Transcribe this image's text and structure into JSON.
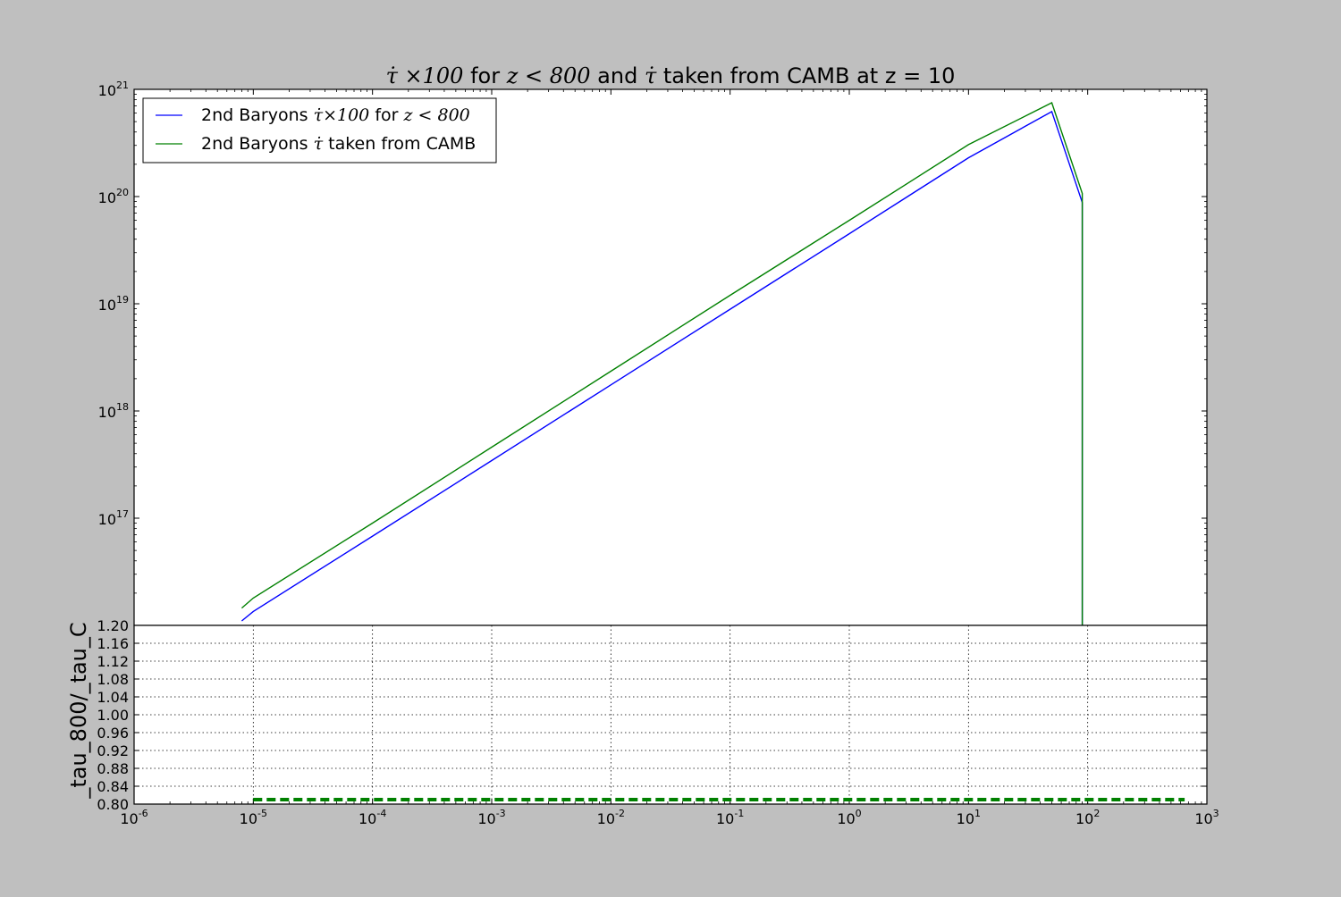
{
  "figure": {
    "background": "#bfbfbf",
    "title_parts": {
      "p1": "τ̇ ×100",
      "p2": " for ",
      "p3": "z < 800",
      "p4": " and ",
      "p5": "τ̇",
      "p6": "  taken from CAMB at z = 10"
    }
  },
  "chart_data": [
    {
      "type": "line",
      "panel": "top",
      "xscale": "log",
      "yscale": "log",
      "xlim": [
        1e-06,
        1000
      ],
      "ylim": [
        1e+16,
        1e+21
      ],
      "y_tick_labels": [
        {
          "base": "10",
          "exp": "17",
          "value": 1e+17
        },
        {
          "base": "10",
          "exp": "18",
          "value": 1e+18
        },
        {
          "base": "10",
          "exp": "19",
          "value": 1e+19
        },
        {
          "base": "10",
          "exp": "20",
          "value": 1e+20
        },
        {
          "base": "10",
          "exp": "21",
          "value": 1e+21
        }
      ],
      "legend": {
        "placement": "top-left",
        "entries": [
          {
            "prefix": "2nd Baryons ",
            "math": "τ̇×100",
            "mid": " for ",
            "math2": "z < 800",
            "color": "#0000ff"
          },
          {
            "prefix": "2nd Baryons ",
            "math": "τ̇",
            "mid": " taken from CAMB",
            "math2": "",
            "color": "#008000"
          }
        ]
      },
      "series": [
        {
          "color": "#0000ff",
          "x": [
            8e-06,
            1e-05,
            0.0001,
            0.001,
            0.01,
            0.1,
            1,
            10,
            50,
            90,
            90
          ],
          "y": [
            1.1e+16,
            1.35e+16,
            6.8e+16,
            3.45e+17,
            1.75e+18,
            8.9e+18,
            4.5e+19,
            2.3e+20,
            6.2e+20,
            8.8e+19,
            1e+16
          ]
        },
        {
          "color": "#008000",
          "x": [
            8e-06,
            1e-05,
            0.0001,
            0.001,
            0.01,
            0.1,
            1,
            10,
            50,
            90,
            90
          ],
          "y": [
            1.45e+16,
            1.8e+16,
            9e+16,
            4.6e+17,
            2.35e+18,
            1.2e+19,
            6e+19,
            3.05e+20,
            7.5e+20,
            1.07e+20,
            1e+16
          ]
        }
      ]
    },
    {
      "type": "line",
      "panel": "bottom",
      "xscale": "log",
      "xlim": [
        1e-06,
        1000
      ],
      "ylim": [
        0.8,
        1.2
      ],
      "ylabel": "_tau_800/_tau_C",
      "grid": true,
      "y_tick_labels": [
        "0.80",
        "0.84",
        "0.88",
        "0.92",
        "0.96",
        "1.00",
        "1.04",
        "1.08",
        "1.12",
        "1.16",
        "1.20"
      ],
      "x_tick_labels": [
        {
          "base": "10",
          "exp": "-6",
          "value": 1e-06
        },
        {
          "base": "10",
          "exp": "-5",
          "value": 1e-05
        },
        {
          "base": "10",
          "exp": "-4",
          "value": 0.0001
        },
        {
          "base": "10",
          "exp": "-3",
          "value": 0.001
        },
        {
          "base": "10",
          "exp": "-2",
          "value": 0.01
        },
        {
          "base": "10",
          "exp": "-1",
          "value": 0.1
        },
        {
          "base": "10",
          "exp": "0",
          "value": 1
        },
        {
          "base": "10",
          "exp": "1",
          "value": 10
        },
        {
          "base": "10",
          "exp": "2",
          "value": 100
        },
        {
          "base": "10",
          "exp": "3",
          "value": 1000
        }
      ],
      "series": [
        {
          "color": "#008000",
          "style": "dashed",
          "x": [
            1e-05,
            650
          ],
          "y": [
            0.81,
            0.81
          ]
        }
      ]
    }
  ]
}
